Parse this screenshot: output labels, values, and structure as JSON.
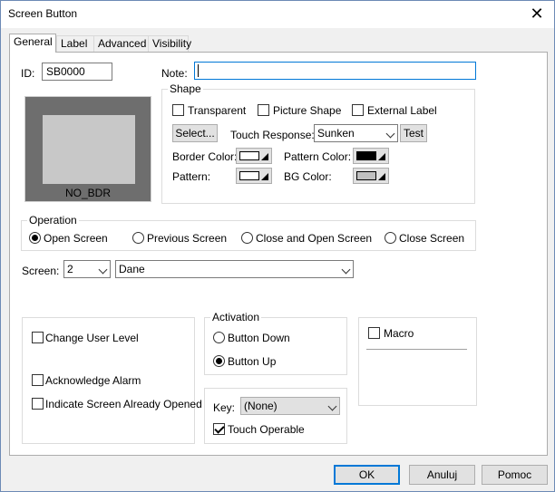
{
  "window": {
    "title": "Screen Button"
  },
  "tabs": [
    {
      "label": "General"
    },
    {
      "label": "Label"
    },
    {
      "label": "Advanced"
    },
    {
      "label": "Visibility"
    }
  ],
  "general": {
    "id_label": "ID:",
    "id_value": "SB0000",
    "note_label": "Note:",
    "note_value": "",
    "preview_caption": "NO_BDR"
  },
  "shape": {
    "title": "Shape",
    "transparent": "Transparent",
    "picture_shape": "Picture Shape",
    "external_label": "External Label",
    "select_button": "Select...",
    "touch_response_label": "Touch Response:",
    "touch_response_value": "Sunken",
    "test_button": "Test",
    "border_color_label": "Border Color:",
    "pattern_color_label": "Pattern Color:",
    "pattern_label": "Pattern:",
    "bg_color_label": "BG Color:"
  },
  "colors": {
    "border_color": "#ffffff",
    "pattern_color": "#000000",
    "pattern": "#ffffff",
    "bg_color": "#c0c0c0"
  },
  "operation": {
    "title": "Operation",
    "options": [
      "Open Screen",
      "Previous Screen",
      "Close and Open Screen",
      "Close Screen"
    ],
    "selected": "Open Screen"
  },
  "screen": {
    "label": "Screen:",
    "number": "2",
    "name": "Dane"
  },
  "options": {
    "change_user_level": "Change User Level",
    "acknowledge_alarm": "Acknowledge Alarm",
    "indicate_screen": "Indicate Screen Already Opened"
  },
  "activation": {
    "title": "Activation",
    "button_down": "Button Down",
    "button_up": "Button Up",
    "selected": "Button Up"
  },
  "key": {
    "label": "Key:",
    "value": "(None)",
    "touch_operable": "Touch Operable",
    "touch_operable_checked": true
  },
  "macro": {
    "label": "Macro"
  },
  "footer": {
    "ok": "OK",
    "cancel": "Anuluj",
    "help": "Pomoc"
  }
}
